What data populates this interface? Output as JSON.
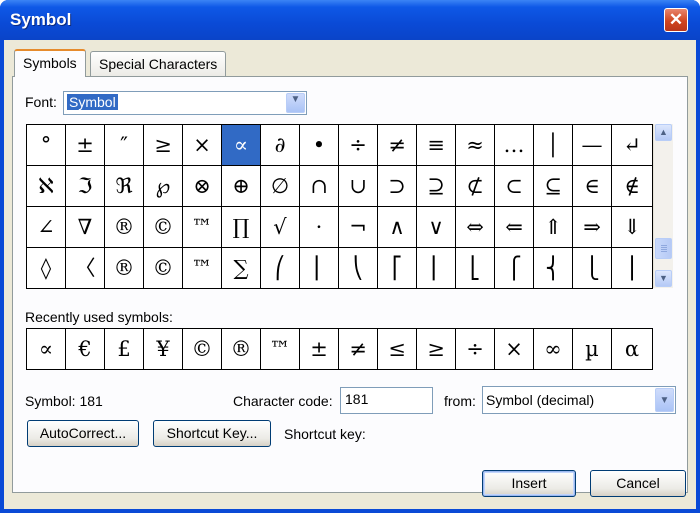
{
  "window": {
    "title": "Symbol",
    "close_glyph": "✕"
  },
  "tabs": [
    {
      "label": "Symbols",
      "active": true
    },
    {
      "label": "Special Characters",
      "active": false
    }
  ],
  "font": {
    "label": "Font:",
    "value": "Symbol"
  },
  "symbol_grid": {
    "selected": "∝",
    "rows": [
      [
        "°",
        "±",
        "″",
        "≥",
        "×",
        "∝",
        "∂",
        "•",
        "÷",
        "≠",
        "≡",
        "≈",
        "…",
        "│",
        "—",
        "↵"
      ],
      [
        "ℵ",
        "ℑ",
        "ℜ",
        "℘",
        "⊗",
        "⊕",
        "∅",
        "∩",
        "∪",
        "⊃",
        "⊇",
        "⊄",
        "⊂",
        "⊆",
        "∈",
        "∉"
      ],
      [
        "∠",
        "∇",
        "®",
        "©",
        "™",
        "∏",
        "√",
        "⋅",
        "¬",
        "∧",
        "∨",
        "⇔",
        "⇐",
        "⇑",
        "⇒",
        "⇓"
      ],
      [
        "◊",
        "〈",
        "®",
        "©",
        "™",
        "∑",
        "⎛",
        "⎜",
        "⎝",
        "⎡",
        "⎢",
        "⎣",
        "⎧",
        "⎨",
        "⎩",
        "⎪"
      ]
    ]
  },
  "recent": {
    "label": "Recently used symbols:",
    "symbols": [
      "∝",
      "€",
      "£",
      "¥",
      "©",
      "®",
      "™",
      "±",
      "≠",
      "≤",
      "≥",
      "÷",
      "×",
      "∞",
      "µ",
      "α"
    ]
  },
  "symbol_info": {
    "text": "Symbol: 181"
  },
  "character_code": {
    "label": "Character code:",
    "value": "181"
  },
  "from": {
    "label": "from:",
    "value": "Symbol (decimal)"
  },
  "buttons": {
    "autocorrect": "AutoCorrect...",
    "shortcut_key": "Shortcut Key...",
    "insert": "Insert",
    "cancel": "Cancel"
  },
  "shortcut_key_label": "Shortcut key:",
  "colors": {
    "title_bar": "#0a4ad6",
    "selection": "#316ac5",
    "dialog_bg": "#ece9d8",
    "close_button": "#d0451e"
  }
}
